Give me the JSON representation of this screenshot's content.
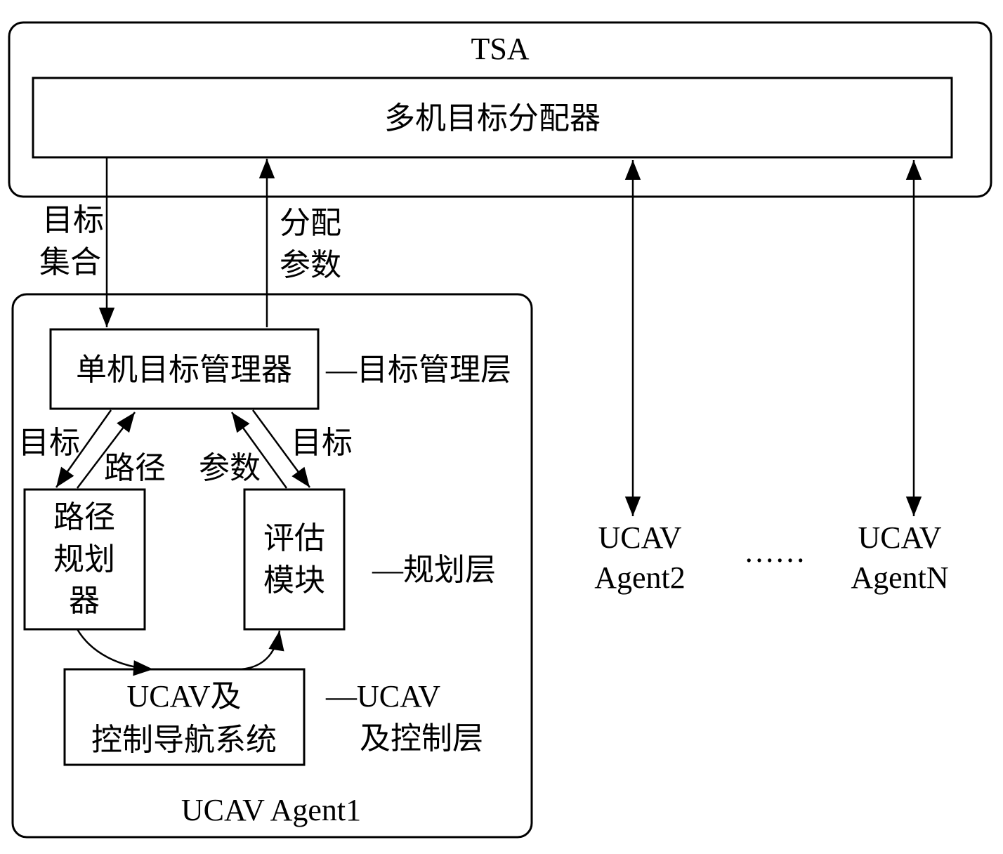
{
  "tsa": {
    "title": "TSA",
    "allocator_label": "多机目标分配器"
  },
  "links": {
    "target_set": [
      "目标",
      "集合"
    ],
    "allocation_params": [
      "分配",
      "参数"
    ]
  },
  "agent1": {
    "label": "UCAV Agent1",
    "single_manager": "单机目标管理器",
    "target_mgmt_layer": "—目标管理层",
    "path_planner": [
      "路径",
      "规划",
      "器"
    ],
    "evaluation_module": [
      "评估",
      "模块"
    ],
    "planning_layer": "—规划层",
    "ucav_nav": [
      "UCAV及",
      "控制导航系统"
    ],
    "ucav_layer": [
      "—UCAV",
      "及控制层"
    ],
    "arrow_labels": {
      "target_left": "目标",
      "path": "路径",
      "params": "参数",
      "target_right": "目标"
    }
  },
  "other_agents": [
    {
      "line1": "UCAV",
      "line2": "Agent2"
    },
    {
      "line1": "UCAV",
      "line2": "AgentN"
    }
  ],
  "ellipsis": "……"
}
